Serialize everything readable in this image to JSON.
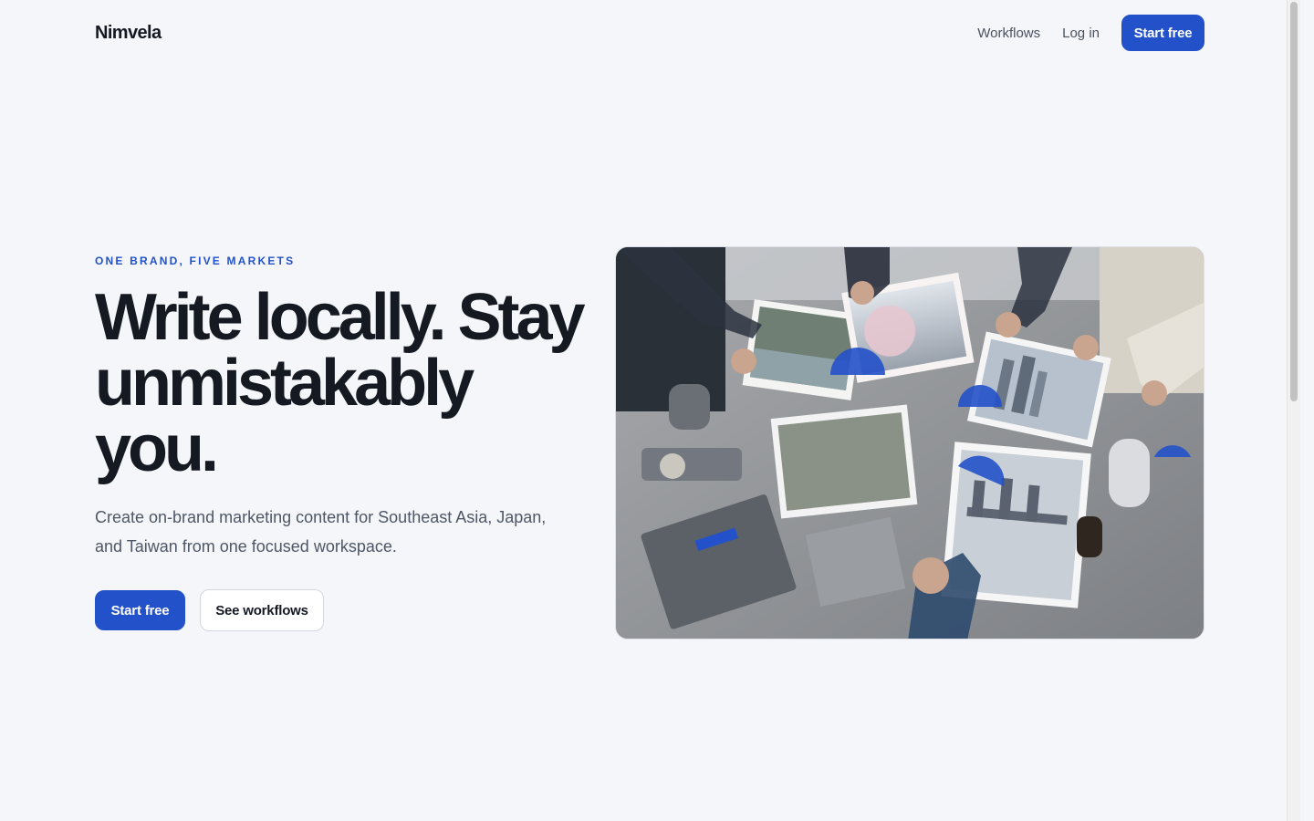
{
  "header": {
    "brand": "Nimvela",
    "nav": {
      "workflows": "Workflows",
      "login": "Log in"
    },
    "cta": "Start free"
  },
  "hero": {
    "eyebrow": "ONE BRAND, FIVE MARKETS",
    "headline": "Write locally. Stay unmistakably you.",
    "subhead": "Create on-brand marketing content for Southeast Asia, Japan, and Taiwan from one focused workspace.",
    "primary_cta": "Start free",
    "secondary_cta": "See workflows",
    "image": {
      "icon": "photo-collaboration-table",
      "colors": {
        "accent": "#2351c9",
        "table": "#8e9196"
      }
    }
  },
  "theme": {
    "background": "#f4f6f9",
    "primary": "#2351c9",
    "text": "#151a22",
    "muted": "#4f5766"
  }
}
